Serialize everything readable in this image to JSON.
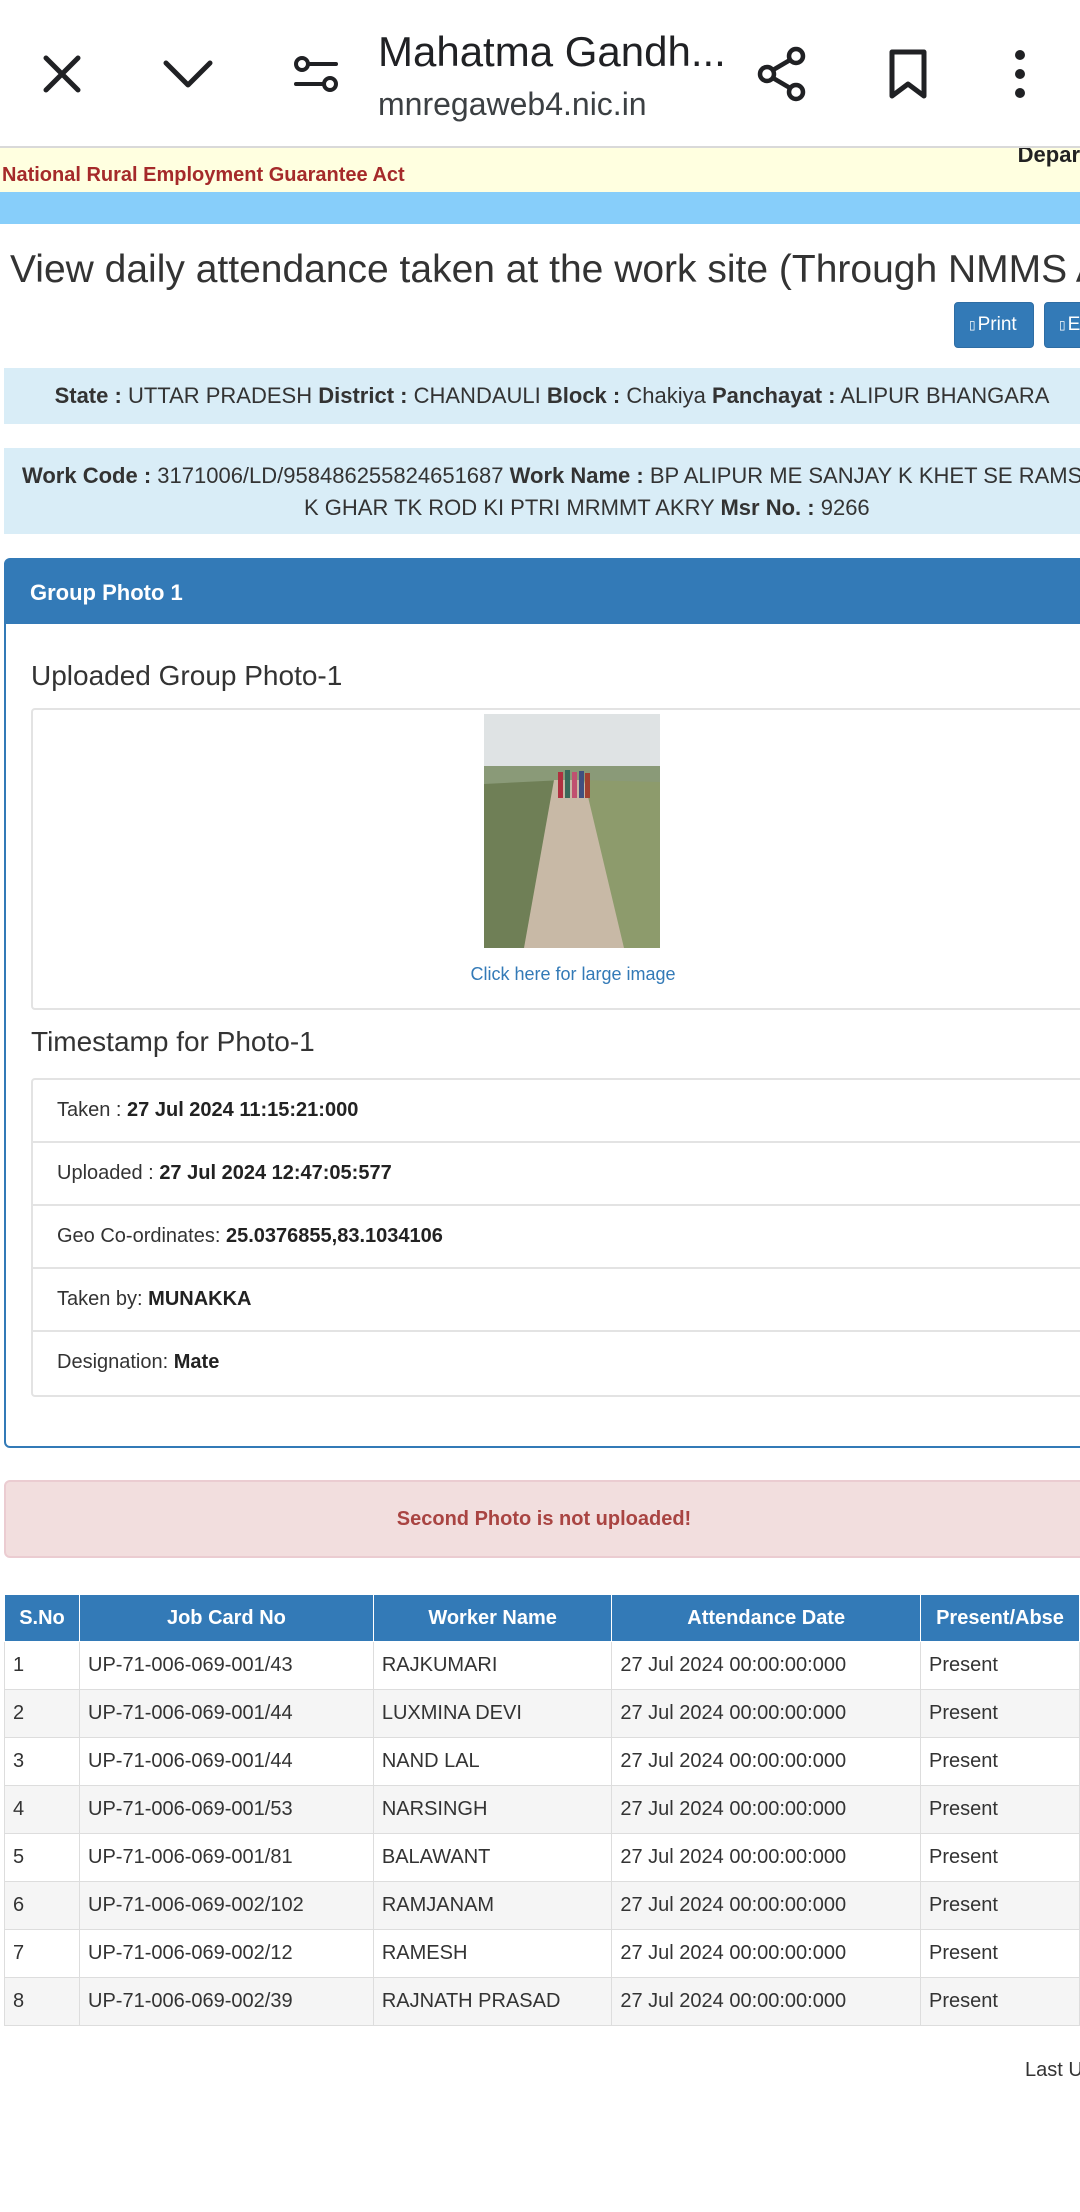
{
  "browser": {
    "title": "Mahatma Gandh...",
    "url": "mnregaweb4.nic.in",
    "icons": [
      "close-icon",
      "chevron-down-icon",
      "site-settings-icon",
      "share-icon",
      "bookmark-icon",
      "more-vert-icon"
    ]
  },
  "banner": {
    "dept_fragment": "Depar",
    "act": "National Rural Employment Guarantee Act"
  },
  "heading": "View daily attendance taken at the work site (Through NMMS Ap",
  "buttons": {
    "print": "Print",
    "excel": "E"
  },
  "location": {
    "state_label": "State :",
    "state": "UTTAR PRADESH",
    "district_label": "District :",
    "district": "CHANDAULI",
    "block_label": "Block :",
    "block": "Chakiya",
    "panchayat_label": "Panchayat :",
    "panchayat": "ALIPUR BHANGARA"
  },
  "work": {
    "code_label": "Work Code :",
    "code": "3171006/LD/958486255824651687",
    "name_label": "Work Name :",
    "name_line1": "BP ALIPUR ME SANJAY K KHET SE RAMSING",
    "name_line2": "K GHAR TK ROD KI PTRI MRMMT AKRY",
    "msr_label": "Msr No. :",
    "msr": "9266"
  },
  "group_photo": {
    "panel_title": "Group Photo 1",
    "uploaded_title": "Uploaded Group Photo-1",
    "link": "Click here for large image",
    "timestamp_title": "Timestamp for Photo-1",
    "taken_label": "Taken :",
    "taken": "27 Jul 2024 11:15:21:000",
    "uploaded_label": "Uploaded :",
    "uploaded": "27 Jul 2024 12:47:05:577",
    "geo_label": "Geo Co-ordinates:",
    "geo": "25.0376855,83.1034106",
    "taken_by_label": "Taken by:",
    "taken_by": "MUNAKKA",
    "designation_label": "Designation:",
    "designation": "Mate"
  },
  "alert": "Second Photo is not uploaded!",
  "table": {
    "headers": [
      "S.No",
      "Job Card No",
      "Worker Name",
      "Attendance Date",
      "Present/Abse"
    ],
    "rows": [
      [
        "1",
        "UP-71-006-069-001/43",
        "RAJKUMARI",
        "27 Jul 2024 00:00:00:000",
        "Present"
      ],
      [
        "2",
        "UP-71-006-069-001/44",
        "LUXMINA DEVI",
        "27 Jul 2024 00:00:00:000",
        "Present"
      ],
      [
        "3",
        "UP-71-006-069-001/44",
        "NAND LAL",
        "27 Jul 2024 00:00:00:000",
        "Present"
      ],
      [
        "4",
        "UP-71-006-069-001/53",
        "NARSINGH",
        "27 Jul 2024 00:00:00:000",
        "Present"
      ],
      [
        "5",
        "UP-71-006-069-001/81",
        "BALAWANT",
        "27 Jul 2024 00:00:00:000",
        "Present"
      ],
      [
        "6",
        "UP-71-006-069-002/102",
        "RAMJANAM",
        "27 Jul 2024 00:00:00:000",
        "Present"
      ],
      [
        "7",
        "UP-71-006-069-002/12",
        "RAMESH",
        "27 Jul 2024 00:00:00:000",
        "Present"
      ],
      [
        "8",
        "UP-71-006-069-002/39",
        "RAJNATH PRASAD",
        "27 Jul 2024 00:00:00:000",
        "Present"
      ]
    ]
  },
  "footer": {
    "last_updated_fragment": "Last U"
  },
  "colors": {
    "primary": "#337ab7",
    "banner_yellow": "#ffffe0",
    "banner_blue": "#87cefa",
    "info_bg": "#d9edf7",
    "alert_bg": "#f2dede",
    "alert_text": "#a94442",
    "act_text": "#a52a2a"
  }
}
